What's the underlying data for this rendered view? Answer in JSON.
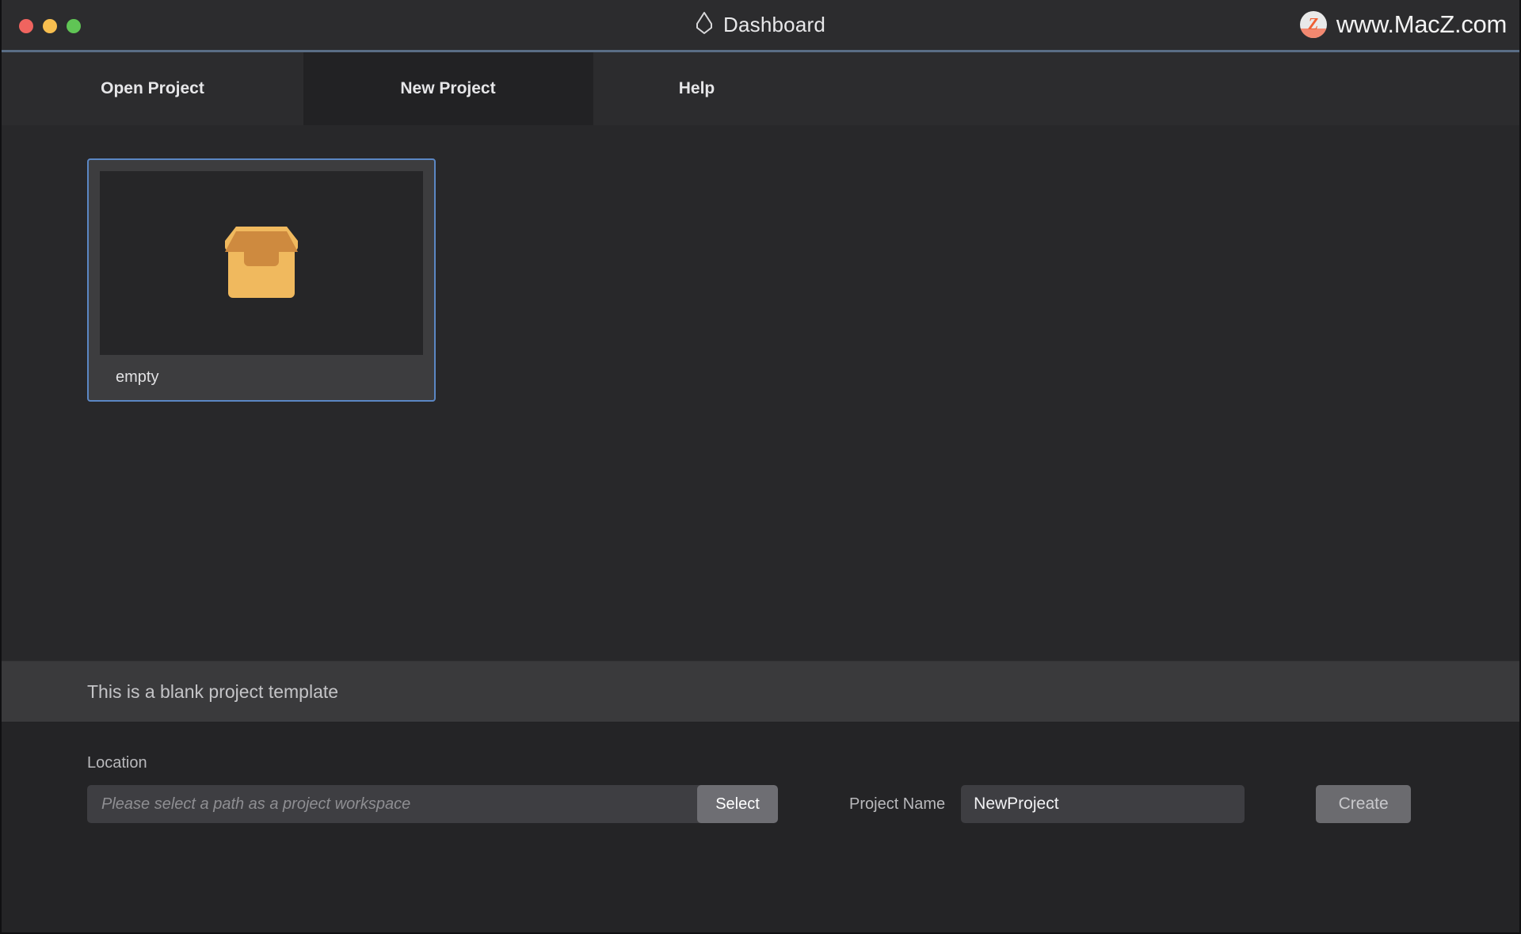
{
  "window": {
    "title": "Dashboard",
    "title_icon": "water-drop-icon",
    "traffic_lights": {
      "close": "close-window-button",
      "minimize": "minimize-window-button",
      "zoom": "zoom-window-button"
    },
    "watermark": {
      "logo_letter": "Z",
      "text": "www.MacZ.com"
    }
  },
  "tabs": [
    {
      "label": "Open Project",
      "name": "tab-open-project",
      "selected": false
    },
    {
      "label": "New Project",
      "name": "tab-new-project",
      "selected": true
    },
    {
      "label": "Help",
      "name": "tab-help",
      "selected": false
    }
  ],
  "templates": [
    {
      "label": "empty",
      "icon": "open-box-icon",
      "selected": true
    }
  ],
  "description": "This is a blank project template",
  "form": {
    "location_label": "Location",
    "path_value": "",
    "path_placeholder": "Please select a path as a project workspace",
    "select_label": "Select",
    "project_name_label": "Project Name",
    "project_name_value": "NewProject",
    "create_label": "Create"
  },
  "colors": {
    "accent_blue": "#5b87c4",
    "titlebar_rule": "#5a6d85",
    "box_fill": "#f0b95e",
    "box_shadow": "#ce8a3f",
    "window_bg": "#28282a",
    "watermark_orange": "#ef5f33"
  }
}
